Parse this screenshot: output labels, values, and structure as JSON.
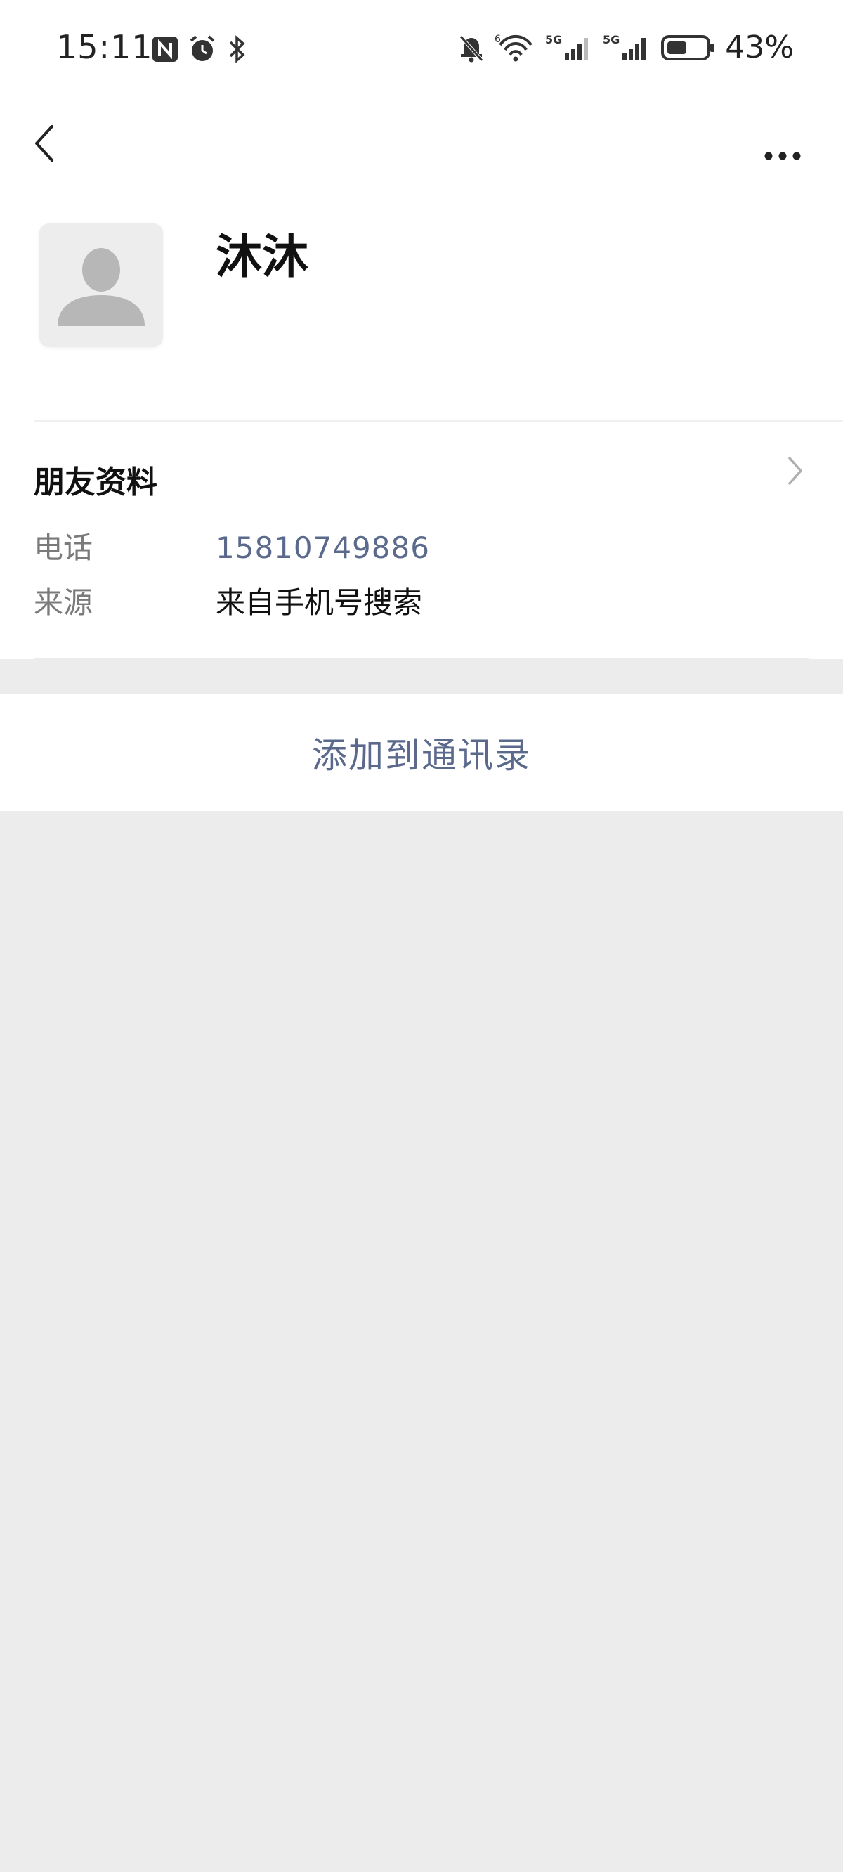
{
  "status_bar": {
    "time": "15:11",
    "battery_percent": "43%",
    "left_icons": [
      "nfc-icon",
      "alarm-icon",
      "bluetooth-icon"
    ],
    "right_icons": [
      "bell-muted-icon",
      "wifi-icon",
      "signal-5g-icon",
      "signal-5g-icon",
      "battery-icon"
    ]
  },
  "nav": {
    "back_icon": "chevron-left-icon",
    "more_icon": "more-dots-icon"
  },
  "profile": {
    "name": "沐沐",
    "avatar_icon": "default-avatar-icon"
  },
  "info": {
    "title": "朋友资料",
    "rows": [
      {
        "label": "电话",
        "value": "15810749886"
      },
      {
        "label": "来源",
        "value": "来自手机号搜索"
      }
    ]
  },
  "action": {
    "label": "添加到通讯录"
  },
  "colors": {
    "accent_link": "#5b6a8c",
    "page_bg": "#ececec",
    "card_bg": "#ffffff"
  }
}
